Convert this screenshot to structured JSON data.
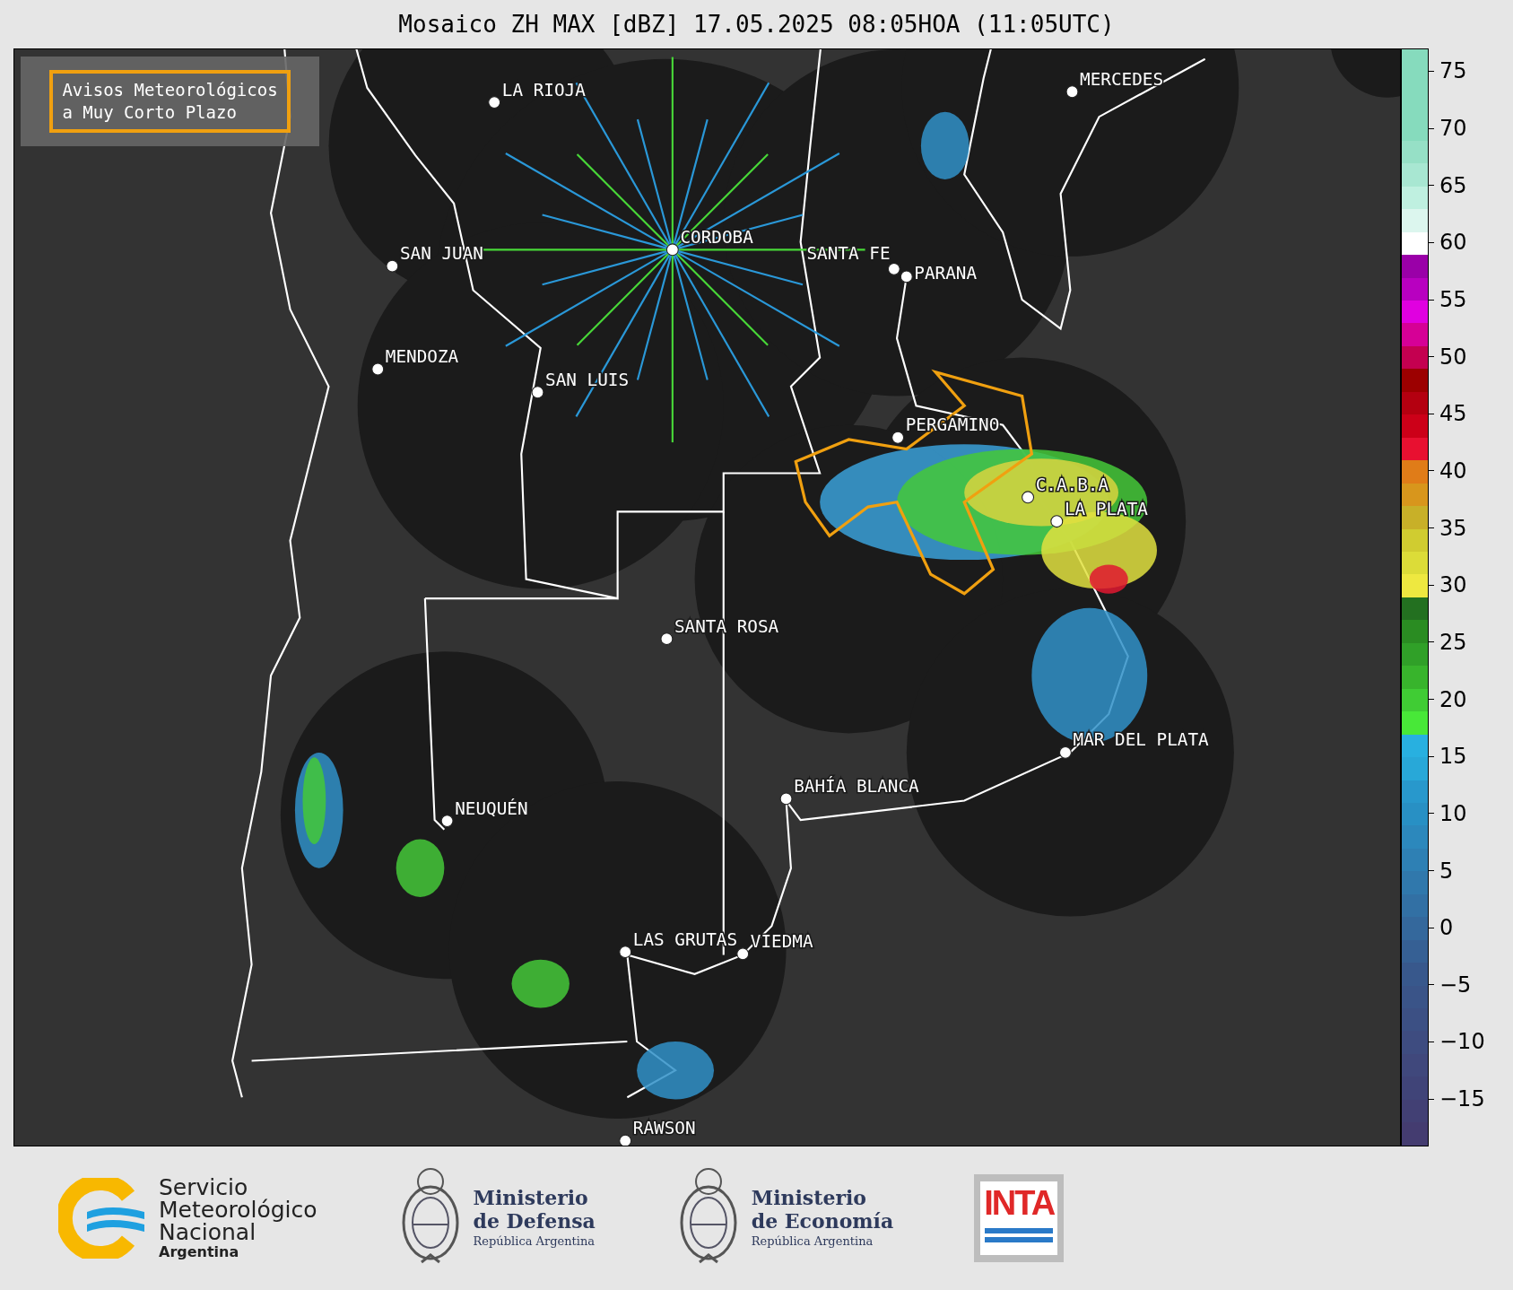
{
  "title": "Mosaico ZH MAX [dBZ] 17.05.2025 08:05HOA (11:05UTC)",
  "legend": {
    "lines": [
      "Avisos Meteorológicos",
      "a Muy Corto Plazo"
    ]
  },
  "cities": [
    {
      "name": "LA RIOJA"
    },
    {
      "name": "CORDOBA"
    },
    {
      "name": "SAN JUAN"
    },
    {
      "name": "SANTA FE"
    },
    {
      "name": "PARANA"
    },
    {
      "name": "MERCEDES"
    },
    {
      "name": "MENDOZA"
    },
    {
      "name": "SAN LUIS"
    },
    {
      "name": "PERGAMINO"
    },
    {
      "name": "C.A.B.A"
    },
    {
      "name": "LA PLATA"
    },
    {
      "name": "SANTA ROSA"
    },
    {
      "name": "MAR DEL PLATA"
    },
    {
      "name": "BAHÍA BLANCA"
    },
    {
      "name": "NEUQUÉN"
    },
    {
      "name": "LAS GRUTAS"
    },
    {
      "name": "VIEDMA"
    },
    {
      "name": "RAWSON"
    }
  ],
  "colorbar": {
    "ticks": [
      "75",
      "70",
      "65",
      "60",
      "55",
      "50",
      "45",
      "40",
      "35",
      "30",
      "25",
      "20",
      "15",
      "10",
      "5",
      "0",
      "−5",
      "−10",
      "−15"
    ]
  },
  "footer": {
    "logos": [
      {
        "kind": "smn",
        "lines": [
          "Servicio",
          "Meteorológico",
          "Nacional"
        ],
        "subtitle": "Argentina"
      },
      {
        "kind": "ministry",
        "lines": [
          "Ministerio",
          "de Defensa"
        ],
        "subtitle": "República Argentina"
      },
      {
        "kind": "ministry",
        "lines": [
          "Ministerio",
          "de Economía"
        ],
        "subtitle": "República Argentina"
      },
      {
        "kind": "inta",
        "lines": [
          "INTA"
        ]
      }
    ]
  }
}
